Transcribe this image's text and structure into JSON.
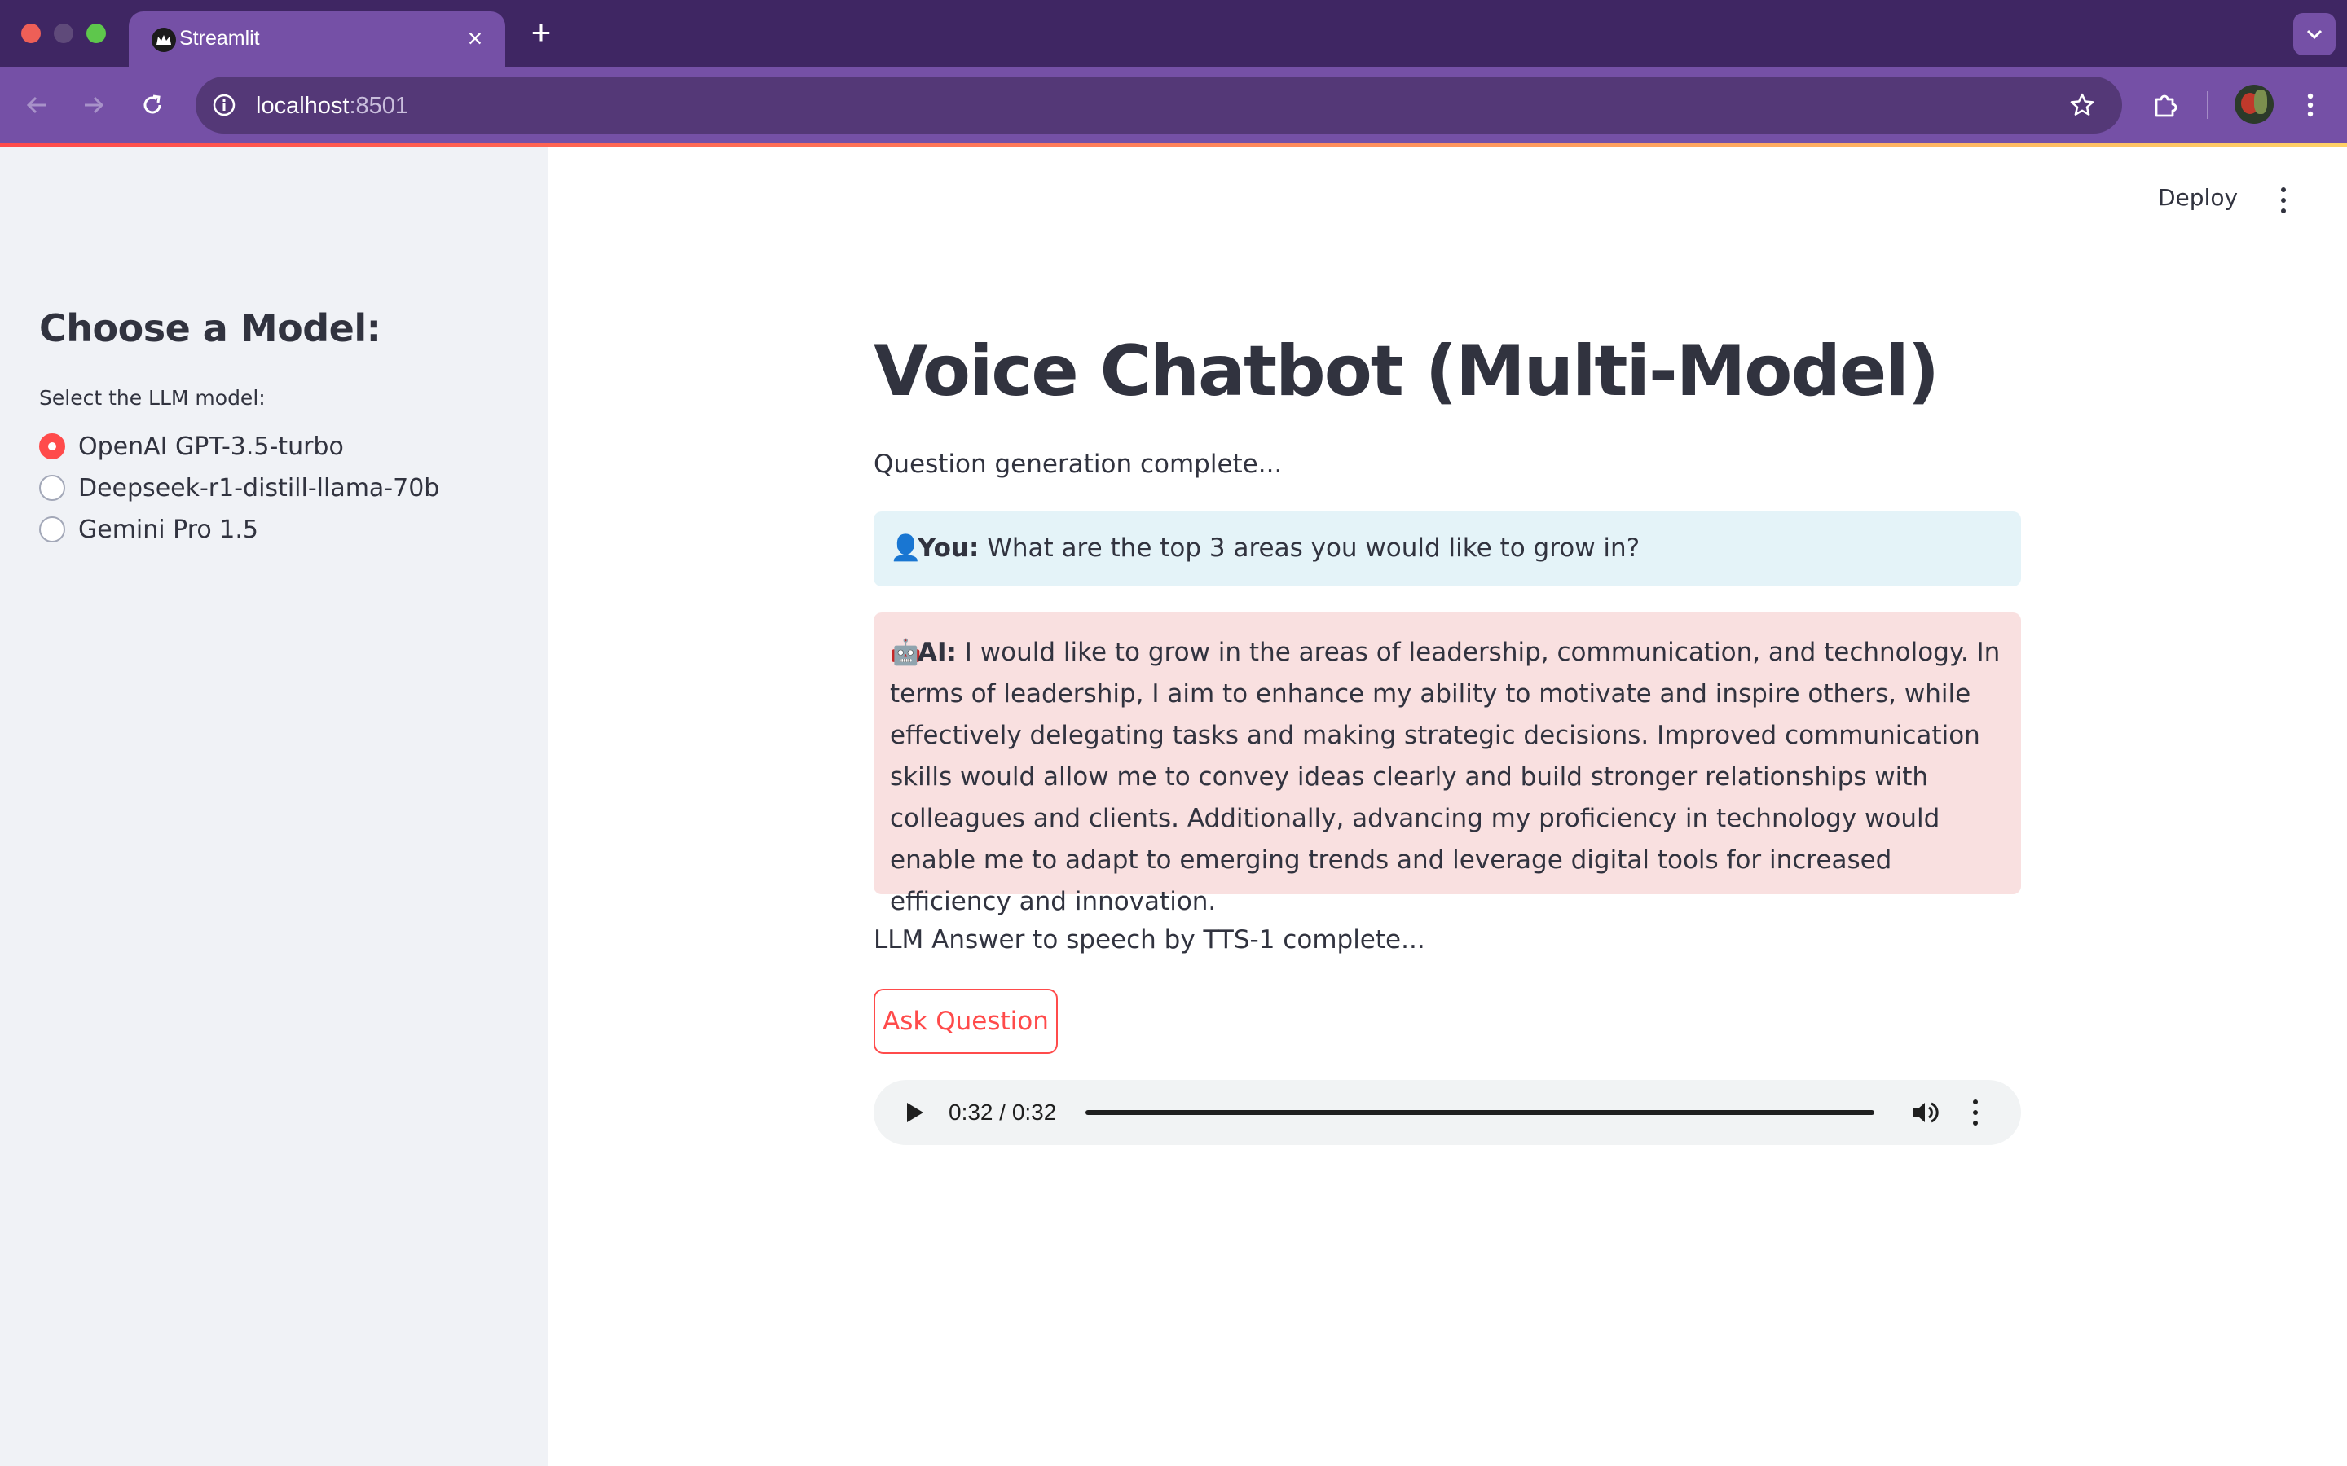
{
  "browser": {
    "tab_title": "Streamlit",
    "url_host": "localhost",
    "url_port": ":8501"
  },
  "sidebar": {
    "title": "Choose a Model:",
    "radio_label": "Select the LLM model:",
    "options": [
      {
        "label": "OpenAI GPT-3.5-turbo",
        "selected": true
      },
      {
        "label": "Deepseek-r1-distill-llama-70b",
        "selected": false
      },
      {
        "label": "Gemini Pro 1.5",
        "selected": false
      }
    ]
  },
  "header": {
    "deploy_label": "Deploy"
  },
  "main": {
    "title": "Voice Chatbot (Multi-Model)",
    "status_question": "Question generation complete...",
    "user_message": {
      "emoji": "👤",
      "speaker": "You:",
      "text": "What are the top 3 areas you would like to grow in?"
    },
    "ai_message": {
      "emoji": "🤖",
      "speaker": "AI:",
      "text": "I would like to grow in the areas of leadership, communication, and technology. In terms of leadership, I aim to enhance my ability to motivate and inspire others, while effectively delegating tasks and making strategic decisions. Improved communication skills would allow me to convey ideas clearly and build stronger relationships with colleagues and clients. Additionally, advancing my proficiency in technology would enable me to adapt to emerging trends and leverage digital tools for increased efficiency and innovation."
    },
    "status_tts": "LLM Answer to speech by TTS-1 complete...",
    "ask_button": "Ask Question",
    "audio": {
      "time": "0:32 / 0:32",
      "progress": 1.0
    }
  },
  "colors": {
    "accent": "#ff4b4b",
    "chrome": "#3f2663",
    "toolbar": "#7550a6",
    "sidebar_bg": "#f0f2f6",
    "user_bubble": "#e4f3f8",
    "ai_bubble": "#f9e0e0",
    "text": "#31333f"
  }
}
